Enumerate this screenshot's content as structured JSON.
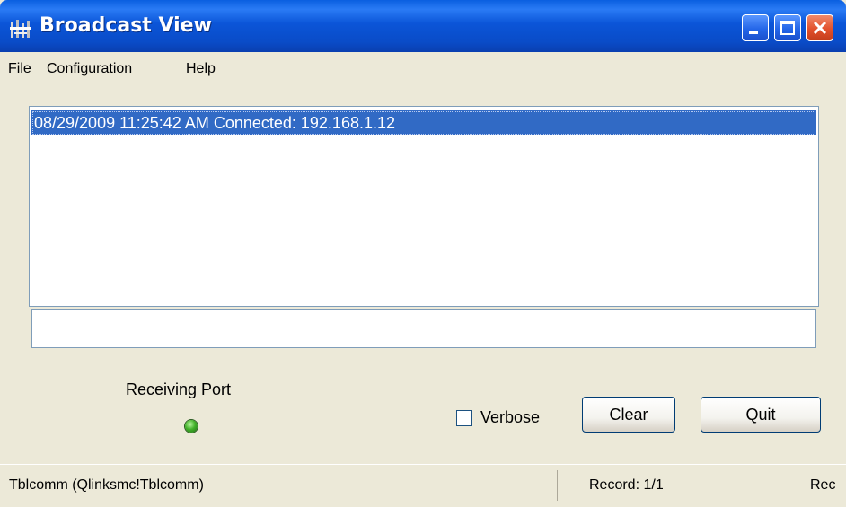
{
  "window": {
    "title": "Broadcast View",
    "titlebar_color": "#0a5fe0",
    "close_color": "#e2512c"
  },
  "menu": {
    "items": [
      "File",
      "Configuration",
      "Help"
    ]
  },
  "log": {
    "entries": [
      "08/29/2009 11:25:42 AM Connected: 192.168.1.12"
    ],
    "selected_index": 0,
    "selection_color": "#316ac5"
  },
  "message_field": {
    "value": ""
  },
  "receiving_port": {
    "label": "Receiving Port",
    "status": "active",
    "led_color": "#43b12a"
  },
  "controls": {
    "verbose_label": "Verbose",
    "verbose_checked": false,
    "clear_label": "Clear",
    "quit_label": "Quit"
  },
  "statusbar": {
    "connection": "Tblcomm (Qlinksmc!Tblcomm)",
    "record": "Record: 1/1",
    "truncated": "Rec"
  }
}
